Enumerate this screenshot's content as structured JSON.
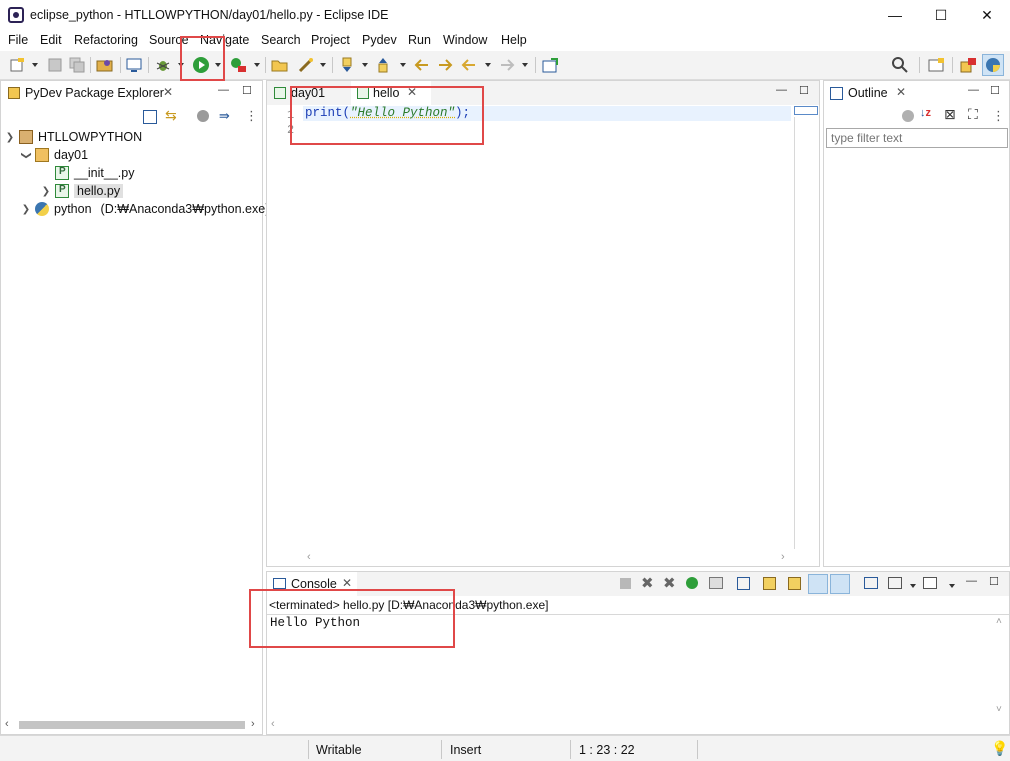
{
  "window": {
    "title": "eclipse_python - HTLLOWPYTHON/day01/hello.py - Eclipse IDE",
    "minimize": "—",
    "maximize": "☐",
    "close": "✕"
  },
  "menu": [
    "File",
    "Edit",
    "Refactoring",
    "Source",
    "Navigate",
    "Search",
    "Project",
    "Pydev",
    "Run",
    "Window",
    "Help"
  ],
  "explorer": {
    "title": "PyDev Package Explorer",
    "tree": {
      "project": "HTLLOWPYTHON",
      "package": "day01",
      "init_file": "__init__.py",
      "hello_file": "hello.py",
      "interpreter": "python",
      "interpreter_path": "(D:₩Anaconda3₩python.exe)"
    }
  },
  "editor": {
    "tabs": [
      {
        "label": "day01"
      },
      {
        "label": "hello"
      }
    ],
    "line_numbers": [
      "1",
      "2"
    ],
    "code": {
      "fn": "print(",
      "string": "\"Hello Python\"",
      "end": ");"
    }
  },
  "outline": {
    "title": "Outline",
    "filter_placeholder": "type filter text"
  },
  "console": {
    "title": "Console",
    "status": "<terminated> hello.py [D:₩Anaconda3₩python.exe]",
    "output": "Hello Python"
  },
  "statusbar": {
    "writable": "Writable",
    "insert": "Insert",
    "position": "1 : 23 : 22"
  },
  "colors": {
    "highlight_red": "#e04848",
    "run_green": "#2e9e3a",
    "string_green": "#2a7a2a",
    "keyword_blue": "#1a3db5"
  },
  "icons": {
    "search": "search-icon",
    "perspective": "open-perspective-icon"
  }
}
